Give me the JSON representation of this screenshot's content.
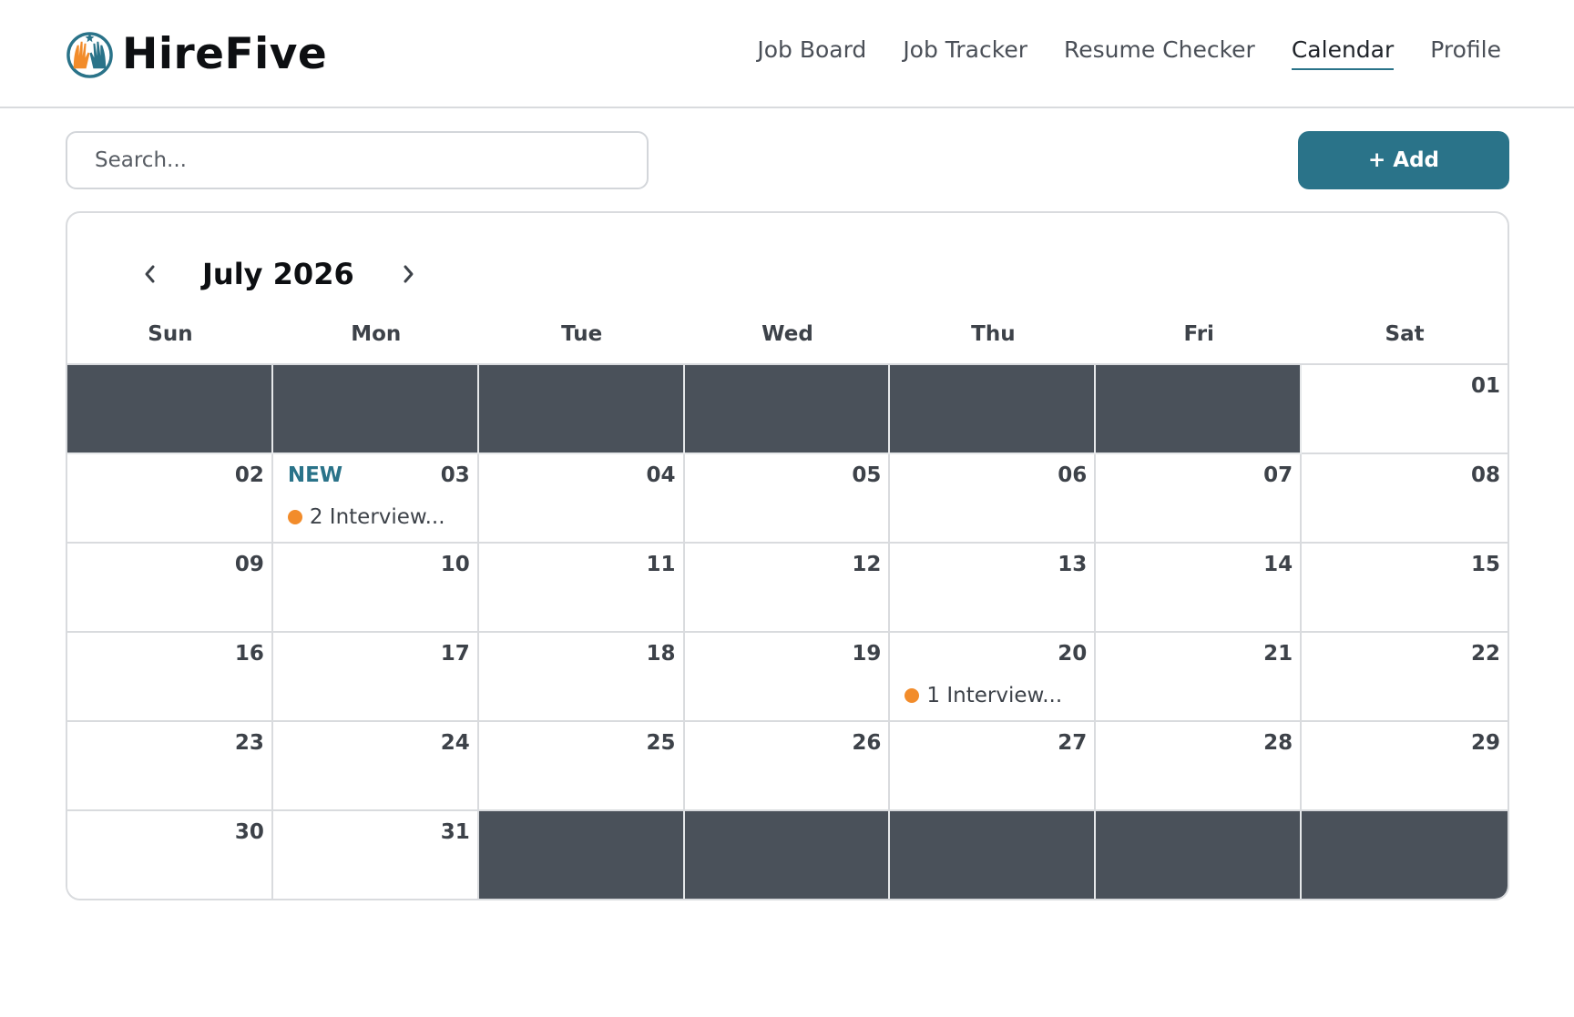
{
  "app": {
    "name": "HireFive",
    "logo_icon": "raised-hands-logo-icon"
  },
  "nav": [
    {
      "label": "Job Board",
      "active": false
    },
    {
      "label": "Job Tracker",
      "active": false
    },
    {
      "label": "Resume Checker",
      "active": false
    },
    {
      "label": "Calendar",
      "active": true
    },
    {
      "label": "Profile",
      "active": false
    }
  ],
  "toolbar": {
    "search_placeholder": "Search...",
    "add_label": "+ Add"
  },
  "calendar": {
    "month_label": "July 2026",
    "prev_icon": "chevron-left-icon",
    "next_icon": "chevron-right-icon",
    "weekdays": [
      "Sun",
      "Mon",
      "Tue",
      "Wed",
      "Thu",
      "Fri",
      "Sat"
    ],
    "leading_empty": 6,
    "trailing_empty": 5,
    "days": [
      "01",
      "02",
      "03",
      "04",
      "05",
      "06",
      "07",
      "08",
      "09",
      "10",
      "11",
      "12",
      "13",
      "14",
      "15",
      "16",
      "17",
      "18",
      "19",
      "20",
      "21",
      "22",
      "23",
      "24",
      "25",
      "26",
      "27",
      "28",
      "29",
      "30",
      "31"
    ],
    "badges": {
      "03": "NEW"
    },
    "events": {
      "03": "2 Interview...",
      "20": "1 Interview..."
    }
  },
  "colors": {
    "accent": "#2a7389",
    "event_dot": "#f28c2b",
    "empty_cell": "#4a515a"
  }
}
